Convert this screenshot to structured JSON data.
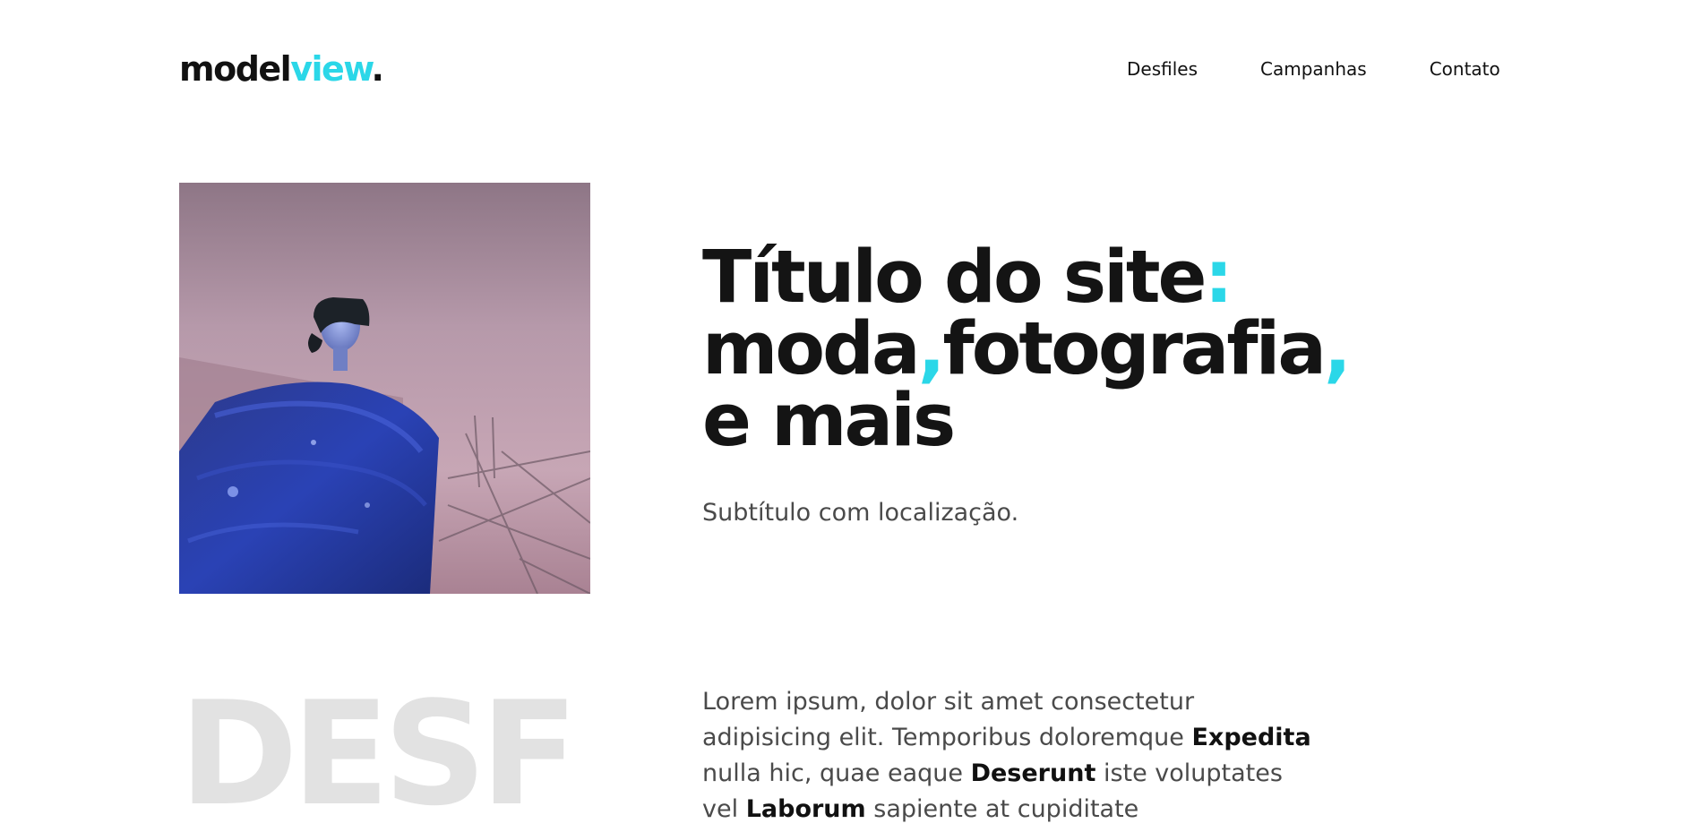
{
  "header": {
    "logo": {
      "part1": "model",
      "part2": "view",
      "part3": "."
    },
    "nav": [
      {
        "label": "Desfiles"
      },
      {
        "label": "Campanhas"
      },
      {
        "label": "Contato"
      }
    ]
  },
  "hero": {
    "title": {
      "line1": "Título do site",
      "colon": ":",
      "line2a": "moda",
      "comma1": ",",
      "line2b": "fotografia",
      "comma2": ",",
      "line3": "e mais"
    },
    "subtitle": "Subtítulo com localização."
  },
  "section": {
    "big_word": "DESF",
    "body": {
      "t1": "Lorem ipsum, dolor sit amet consectetur adipisicing elit. Temporibus doloremque ",
      "b1": "Expedita",
      "t2": " nulla hic, quae eaque ",
      "b2": "Deserunt",
      "t3": " iste voluptates vel ",
      "b3": "Laborum",
      "t4": " sapiente at cupiditate"
    }
  },
  "colors": {
    "accent": "#2bd7e8",
    "text_dark": "#111111",
    "text_muted": "#4a4a4a",
    "big_word": "#e2e2e2"
  }
}
